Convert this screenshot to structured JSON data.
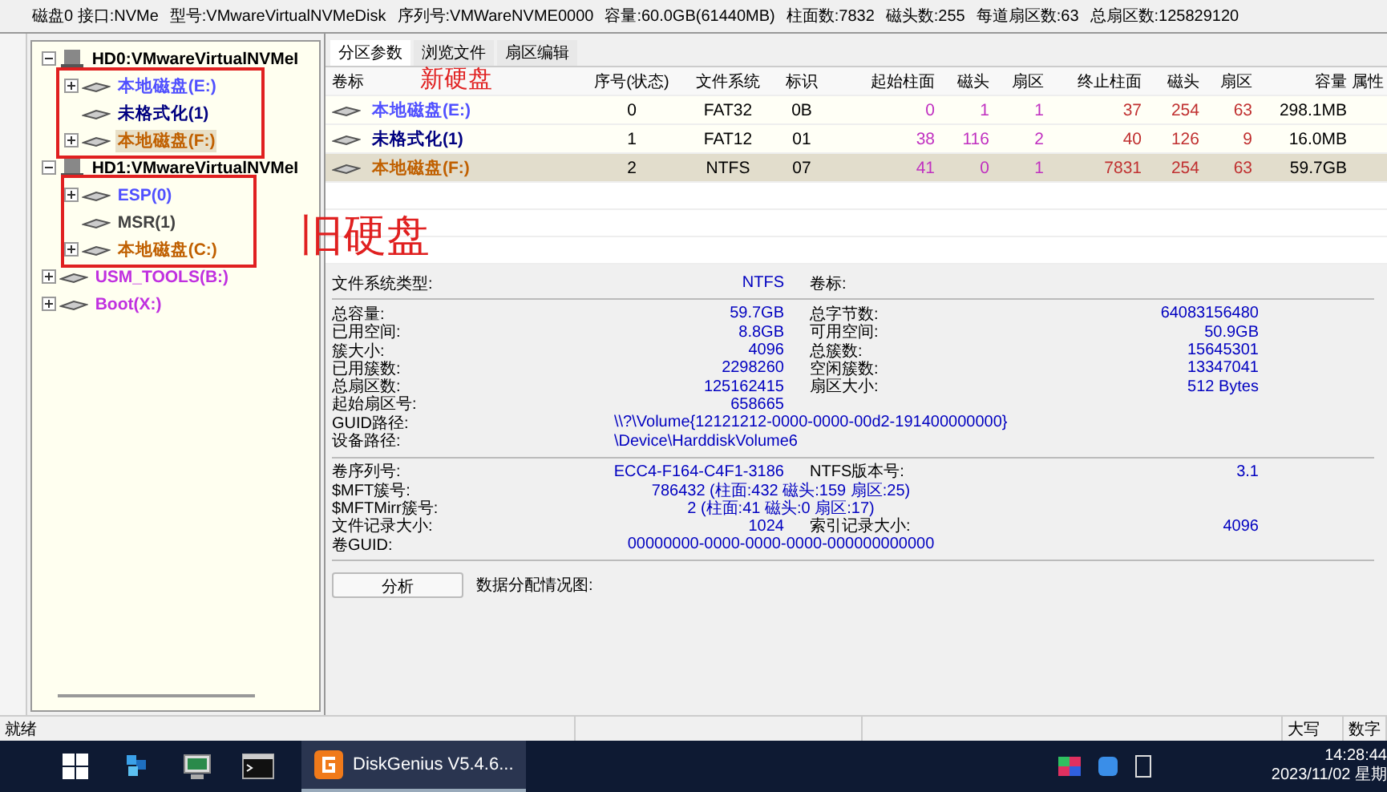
{
  "disk_info": [
    "磁盘0 接口:NVMe",
    "型号:VMwareVirtualNVMeDisk",
    "序列号:VMWareNVME0000",
    "容量:60.0GB(61440MB)",
    "柱面数:7832",
    "磁头数:255",
    "每道扇区数:63",
    "总扇区数:125829120"
  ],
  "tree": [
    {
      "label": "HD0:VMwareVirtualNVMeI",
      "kind": "disk",
      "expanded": true,
      "children": [
        {
          "label": "本地磁盘(E:)",
          "color": "#5050ff",
          "expandable": true,
          "selected": false
        },
        {
          "label": "未格式化(1)",
          "color": "#000080",
          "expandable": false,
          "selected": false
        },
        {
          "label": "本地磁盘(F:)",
          "color": "#c06000",
          "expandable": true,
          "selected": true
        }
      ]
    },
    {
      "label": "HD1:VMwareVirtualNVMeI",
      "kind": "disk",
      "expanded": true,
      "children": [
        {
          "label": "ESP(0)",
          "color": "#5050ff",
          "expandable": true,
          "selected": false
        },
        {
          "label": "MSR(1)",
          "color": "#404040",
          "expandable": false,
          "selected": false
        },
        {
          "label": "本地磁盘(C:)",
          "color": "#c06000",
          "expandable": true,
          "selected": false
        }
      ]
    },
    {
      "label": "USM_TOOLS(B:)",
      "kind": "volume",
      "color": "#c030e0",
      "expanded": false
    },
    {
      "label": "Boot(X:)",
      "kind": "volume",
      "color": "#c030e0",
      "expanded": false
    }
  ],
  "tabs": [
    {
      "label": "分区参数",
      "selected": true
    },
    {
      "label": "浏览文件",
      "selected": false
    },
    {
      "label": "扇区编辑",
      "selected": false
    }
  ],
  "table": {
    "columns": [
      "卷标",
      "序号(状态)",
      "文件系统",
      "标识",
      "起始柱面",
      "磁头",
      "扇区",
      "终止柱面",
      "磁头",
      "扇区",
      "容量",
      "属性"
    ],
    "rows": [
      {
        "color": "#5050ff",
        "selected": false,
        "cells": [
          "本地磁盘(E:)",
          "0",
          "FAT32",
          "0B",
          "0",
          "1",
          "1",
          "37",
          "254",
          "63",
          "298.1MB"
        ]
      },
      {
        "color": "#000080",
        "selected": false,
        "cells": [
          "未格式化(1)",
          "1",
          "FAT12",
          "01",
          "38",
          "116",
          "2",
          "40",
          "126",
          "9",
          "16.0MB"
        ]
      },
      {
        "color": "#c06000",
        "selected": true,
        "cells": [
          "本地磁盘(F:)",
          "2",
          "NTFS",
          "07",
          "41",
          "0",
          "1",
          "7831",
          "254",
          "63",
          "59.7GB"
        ]
      }
    ]
  },
  "details": [
    [
      {
        "kind": "pair",
        "label": "文件系统类型:",
        "value": "NTFS",
        "label2": "卷标:"
      }
    ],
    [
      {
        "kind": "pair",
        "label": "总容量:",
        "value": "59.7GB",
        "label2": "总字节数:",
        "value2": "64083156480"
      },
      {
        "kind": "pair",
        "label": "已用空间:",
        "value": "8.8GB",
        "label2": "可用空间:",
        "value2": "50.9GB"
      },
      {
        "kind": "pair",
        "label": "簇大小:",
        "value": "4096",
        "label2": "总簇数:",
        "value2": "15645301"
      },
      {
        "kind": "pair",
        "label": "已用簇数:",
        "value": "2298260",
        "label2": "空闲簇数:",
        "value2": "13347041"
      },
      {
        "kind": "pair",
        "label": "总扇区数:",
        "value": "125162415",
        "label2": "扇区大小:",
        "value2": "512 Bytes"
      },
      {
        "kind": "pair",
        "label": "起始扇区号:",
        "value": "658665"
      },
      {
        "kind": "path",
        "label": "GUID路径:",
        "value": "\\\\?\\Volume{12121212-0000-0000-00d2-191400000000}"
      },
      {
        "kind": "path",
        "label": "设备路径:",
        "value": "\\Device\\HarddiskVolume6"
      }
    ],
    [
      {
        "kind": "pair",
        "label": "卷序列号:",
        "value": "ECC4-F164-C4F1-3186",
        "label2": "NTFS版本号:",
        "value2": "3.1"
      },
      {
        "kind": "center",
        "label": "$MFT簇号:",
        "value": "786432 (柱面:432 磁头:159 扇区:25)"
      },
      {
        "kind": "center",
        "label": "$MFTMirr簇号:",
        "value": "2 (柱面:41 磁头:0 扇区:17)"
      },
      {
        "kind": "pair",
        "label": "文件记录大小:",
        "value": "1024",
        "label2": "索引记录大小:",
        "value2": "4096"
      },
      {
        "kind": "center",
        "label": "卷GUID:",
        "value": "00000000-0000-0000-0000-000000000000"
      }
    ]
  ],
  "analyze_button": "分析",
  "allocation_label": "数据分配情况图:",
  "annotations": [
    {
      "text": "新硬盘"
    },
    {
      "text": "旧硬盘"
    }
  ],
  "status_bar": [
    "就绪",
    "大写",
    "数字"
  ],
  "taskbar": {
    "app": "DiskGenius V5.4.6...",
    "time": "14:28:44",
    "date": "2023/11/02 星期"
  }
}
